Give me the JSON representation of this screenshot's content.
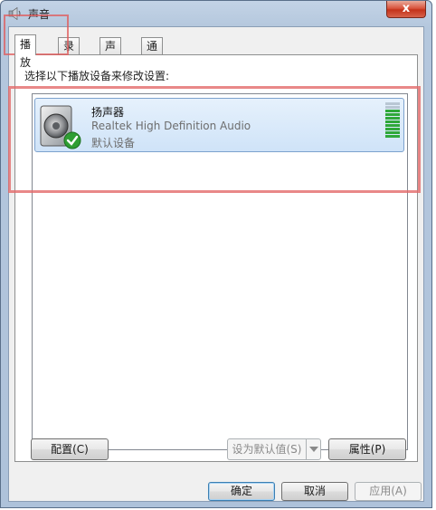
{
  "window": {
    "title": "声音",
    "close_label": "x",
    "title_icon": "speaker-icon"
  },
  "tabs": [
    {
      "label": "播放",
      "active": true
    },
    {
      "label": "录制",
      "active": false
    },
    {
      "label": "声音",
      "active": false
    },
    {
      "label": "通信",
      "active": false
    }
  ],
  "playback": {
    "instruction": "选择以下播放设备来修改设置:",
    "devices": [
      {
        "name": "扬声器",
        "driver": "Realtek High Definition Audio",
        "status": "默认设备",
        "icon": "speaker-icon",
        "status_icon": "checkmark-icon",
        "level_fraction": 0.8
      }
    ]
  },
  "panel_buttons": {
    "configure": "配置(C)",
    "set_default": "设为默认值(S)",
    "properties": "属性(P)"
  },
  "dialog_buttons": {
    "ok": "确定",
    "cancel": "取消",
    "apply": "应用(A)"
  },
  "colors": {
    "selection": "#cfe3f8",
    "level_on": "#2fa83a",
    "level_off": "#b9c7d4",
    "highlight": "#e05a5a"
  }
}
